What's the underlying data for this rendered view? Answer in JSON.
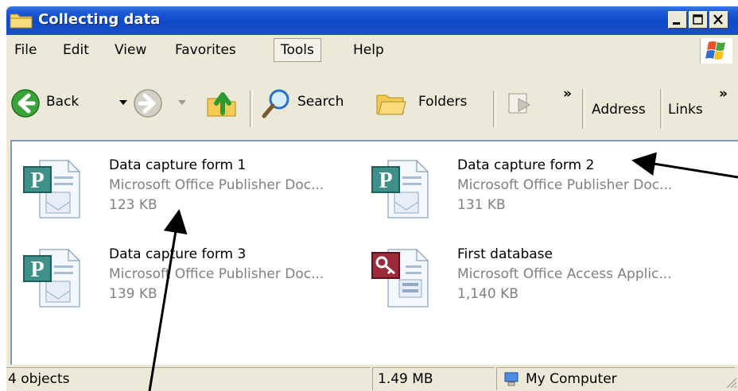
{
  "window": {
    "title": "Collecting data"
  },
  "menu": [
    "File",
    "Edit",
    "View",
    "Favorites",
    "Tools",
    "Help"
  ],
  "menu_selected": "Tools",
  "toolbar": {
    "back": "Back",
    "search": "Search",
    "folders": "Folders",
    "chevron": "»",
    "address": "Address",
    "links": "Links"
  },
  "files": [
    {
      "name": "Data capture form 1",
      "type": "Microsoft Office Publisher Doc...",
      "size": "123 KB",
      "icon": "publisher-icon"
    },
    {
      "name": "Data capture form 2",
      "type": "Microsoft Office Publisher Doc...",
      "size": "131 KB",
      "icon": "publisher-icon"
    },
    {
      "name": "Data capture form 3",
      "type": "Microsoft Office Publisher Doc...",
      "size": "139 KB",
      "icon": "publisher-icon"
    },
    {
      "name": "First database",
      "type": "Microsoft Office Access Applic...",
      "size": "1,140 KB",
      "icon": "access-icon"
    }
  ],
  "status": {
    "objects": "4 objects",
    "size": "1.49 MB",
    "location": "My Computer"
  },
  "colors": {
    "titlebar": "#0d4ac8",
    "chrome": "#ece9d8",
    "arrow": "#000000"
  }
}
